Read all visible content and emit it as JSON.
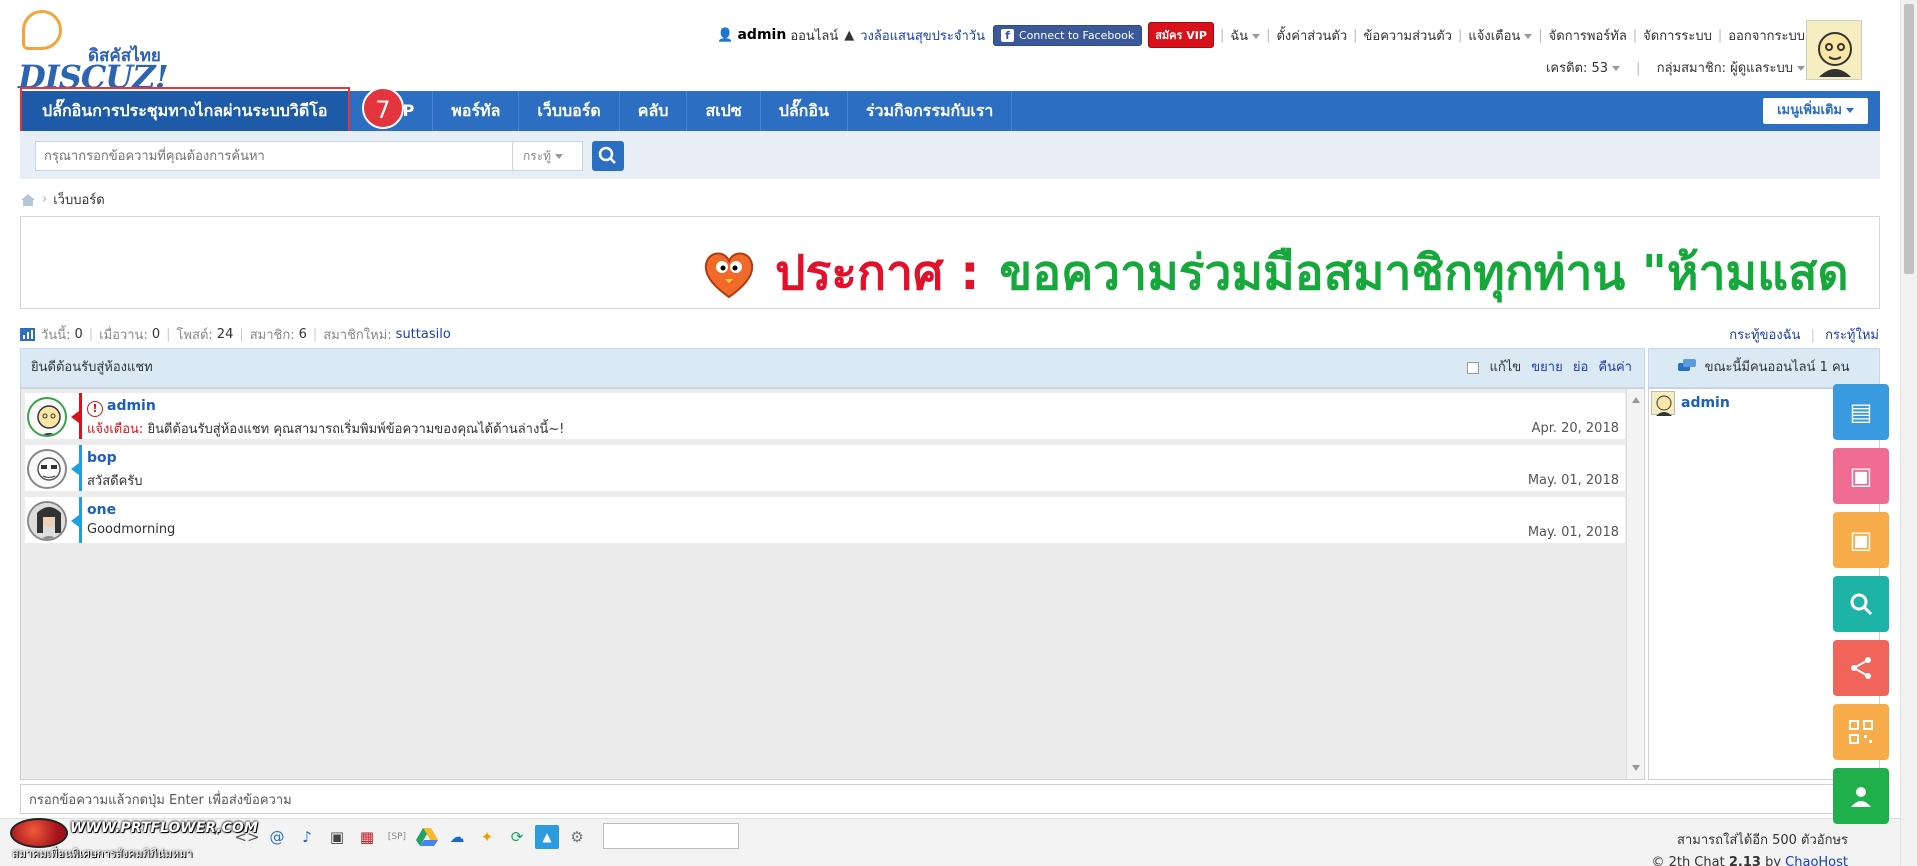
{
  "logo": {
    "thai": "ดิสคัสไทย",
    "word": "DISCUZ!"
  },
  "topbar": {
    "username": "admin",
    "online_label": "ออนไลน์",
    "link_group": "วงล้อแสนสุขประจำวัน",
    "facebook_label": "Connect to Facebook",
    "vip_label": "สมัคร VIP",
    "menu": [
      "ฉัน",
      "ตั้งค่าส่วนตัว",
      "ข้อความส่วนตัว",
      "แจ้งเตือน",
      "จัดการพอร์ทัล",
      "จัดการระบบ",
      "ออกจากระบบ"
    ]
  },
  "subbar": {
    "credit": "เครดิต: 53",
    "group": "กลุ่มสมาชิก: ผู้ดูแลระบบ"
  },
  "nav": {
    "items": [
      "ปลั๊กอินการประชุมทางไกลผ่านระบบวิดีโอ",
      "สู่VIP",
      "พอร์ทัล",
      "เว็บบอร์ด",
      "คลับ",
      "สเปซ",
      "ปลั๊กอิน",
      "ร่วมกิจกรรมกับเรา"
    ],
    "badge": "7",
    "more": "เมนูเพิ่มเติม"
  },
  "search": {
    "placeholder": "กรุณากรอกข้อความที่คุณต้องการค้นหา",
    "scope": "กระทู้"
  },
  "breadcrumb": {
    "current": "เว็บบอร์ด"
  },
  "announcement": {
    "label": "ประกาศ :",
    "text": "ขอความร่วมมือสมาชิกทุกท่าน \"ห้ามแสด"
  },
  "stats": {
    "today_label": "วันนี้:",
    "today": "0",
    "yesterday_label": "เมื่อวาน:",
    "yesterday": "0",
    "posts_label": "โพสต์:",
    "posts": "24",
    "members_label": "สมาชิก:",
    "members": "6",
    "newest_label": "สมาชิกใหม่:",
    "newest": "suttasilo",
    "right_links": [
      "กระทู้ของฉัน",
      "กระทู้ใหม่"
    ]
  },
  "chat": {
    "title": "ยินดีต้อนรับสู่ห้องแชท",
    "edit_label": "แก้ไข",
    "tools": [
      "ขยาย",
      "ย่อ",
      "คืนค่า"
    ],
    "messages": [
      {
        "name": "admin",
        "prefix": "แจ้งเตือน:",
        "text": "ยินดีต้อนรับสู่ห้องแชท คุณสามารถเริ่มพิมพ์ข้อความของคุณได้ด้านล่างนี้~!",
        "date": "Apr. 20, 2018"
      },
      {
        "name": "bop",
        "text": "สวัสดีครับ",
        "date": "May. 01, 2018"
      },
      {
        "name": "one",
        "text": "Goodmorning",
        "date": "May. 01, 2018"
      }
    ],
    "input_value": "กรอกข้อความแล้วกดปุ่ม Enter เพื่อส่งข้อความ"
  },
  "online": {
    "title": "ขณะนี้มีคนออนไลน์ 1 คน",
    "users": [
      "admin"
    ]
  },
  "toolbar": {
    "chars_left": "สามารถใส่ได้อีก 500 ตัวอักษร",
    "credit_prefix": "© 2th Chat",
    "credit_version": "2.13",
    "credit_by": "by",
    "credit_author": "ChaoHost"
  },
  "watermark": {
    "url": "WWW.PRTFLOWER.COM",
    "caption": "สมาคมเพื่อนพิเศษการสังคมภิภีน่มหมา"
  },
  "colors": {
    "nav": "#2c6fc2",
    "accent_red": "#e2102a",
    "accent_green": "#16a83b"
  }
}
